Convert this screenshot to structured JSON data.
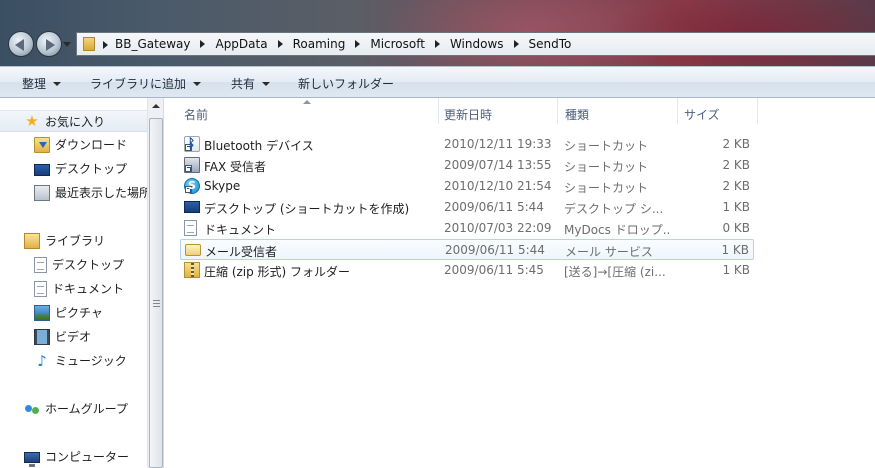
{
  "address_bar": {
    "breadcrumbs": [
      "BB_Gateway",
      "AppData",
      "Roaming",
      "Microsoft",
      "Windows",
      "SendTo"
    ]
  },
  "toolbar": {
    "organize": "整理",
    "include_in_library": "ライブラリに追加",
    "share": "共有",
    "new_folder": "新しいフォルダー"
  },
  "nav": {
    "favorites": "お気に入り",
    "downloads": "ダウンロード",
    "desktop": "デスクトップ",
    "recent": "最近表示した場所",
    "libraries": "ライブラリ",
    "lib_desktop": "デスクトップ",
    "lib_documents": "ドキュメント",
    "lib_pictures": "ピクチャ",
    "lib_videos": "ビデオ",
    "lib_music": "ミュージック",
    "homegroup": "ホームグループ",
    "computer": "コンピューター"
  },
  "columns": {
    "name": "名前",
    "date": "更新日時",
    "type": "種類",
    "size": "サイズ"
  },
  "files": [
    {
      "name": "Bluetooth デバイス",
      "date": "2010/12/11 19:33",
      "type": "ショートカット",
      "size": "2 KB"
    },
    {
      "name": "FAX 受信者",
      "date": "2009/07/14 13:55",
      "type": "ショートカット",
      "size": "2 KB"
    },
    {
      "name": "Skype",
      "date": "2010/12/10 21:54",
      "type": "ショートカット",
      "size": "2 KB"
    },
    {
      "name": "デスクトップ (ショートカットを作成)",
      "date": "2009/06/11 5:44",
      "type": "デスクトップ シ...",
      "size": "1 KB"
    },
    {
      "name": "ドキュメント",
      "date": "2010/07/03 22:09",
      "type": "MyDocs ドロップ...",
      "size": "0 KB"
    },
    {
      "name": "メール受信者",
      "date": "2009/06/11 5:44",
      "type": "メール サービス",
      "size": "1 KB"
    },
    {
      "name": "圧縮 (zip 形式) フォルダー",
      "date": "2009/06/11 5:45",
      "type": "[送る]→[圧縮 (zi...",
      "size": "1 KB"
    }
  ]
}
